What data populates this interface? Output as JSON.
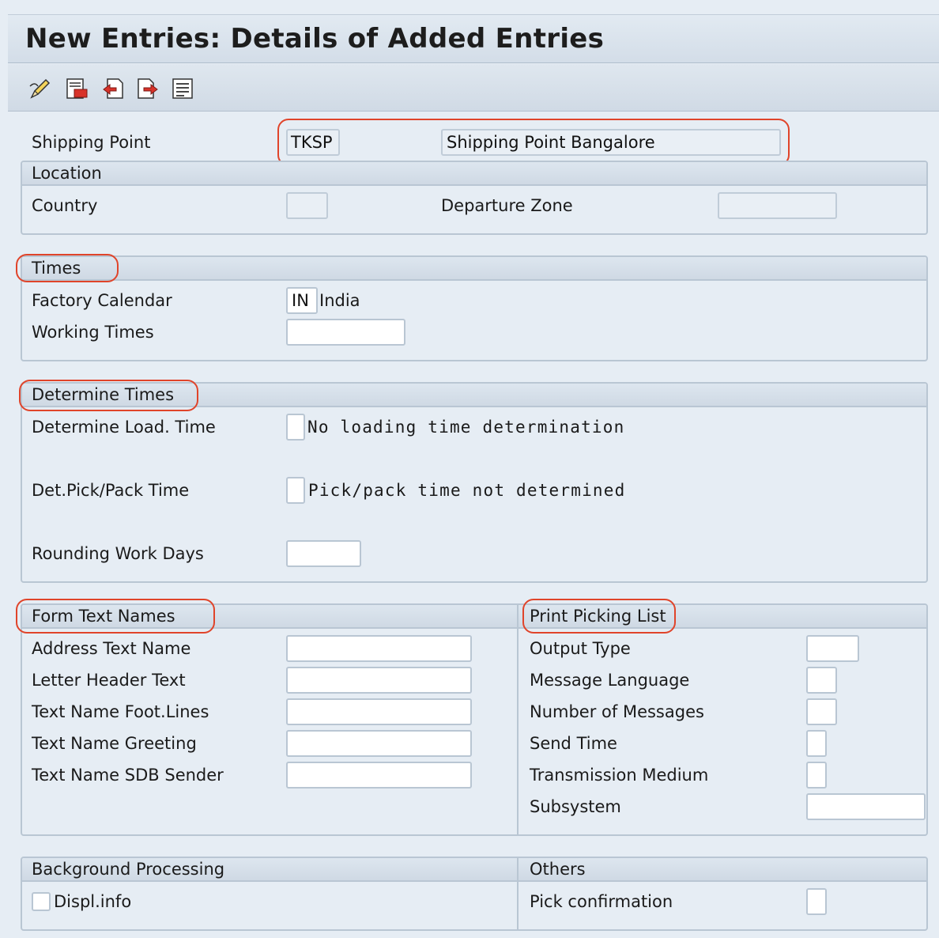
{
  "title": "New Entries: Details of Added Entries",
  "toolbar": {
    "icons": [
      "edit-pen-icon",
      "delete-entry-icon",
      "previous-entry-icon",
      "next-entry-icon",
      "document-list-icon"
    ]
  },
  "header": {
    "shipping_point_label": "Shipping Point",
    "shipping_point_code": "TKSP",
    "shipping_point_desc": "Shipping Point Bangalore"
  },
  "location": {
    "title": "Location",
    "country_label": "Country",
    "country_value": "",
    "departure_zone_label": "Departure Zone",
    "departure_zone_value": ""
  },
  "times": {
    "title": "Times",
    "factory_calendar_label": "Factory Calendar",
    "factory_calendar_code": "IN",
    "factory_calendar_desc": "India",
    "working_times_label": "Working Times",
    "working_times_value": ""
  },
  "determine_times": {
    "title": "Determine Times",
    "load_label": "Determine Load. Time",
    "load_text": "No loading time determination",
    "pick_label": "Det.Pick/Pack Time",
    "pick_text": "Pick/pack time not determined",
    "rounding_label": "Rounding Work Days",
    "rounding_value": ""
  },
  "form_text_names": {
    "title": "Form Text Names",
    "fields": [
      {
        "label": "Address Text Name",
        "value": ""
      },
      {
        "label": "Letter Header Text",
        "value": ""
      },
      {
        "label": "Text Name Foot.Lines",
        "value": ""
      },
      {
        "label": "Text Name Greeting",
        "value": ""
      },
      {
        "label": "Text Name SDB Sender",
        "value": ""
      }
    ]
  },
  "print_picking_list": {
    "title": "Print Picking List",
    "fields": [
      {
        "label": "Output Type",
        "value": ""
      },
      {
        "label": "Message Language",
        "value": ""
      },
      {
        "label": "Number of Messages",
        "value": ""
      },
      {
        "label": "Send Time",
        "value": ""
      },
      {
        "label": "Transmission Medium",
        "value": ""
      },
      {
        "label": "Subsystem",
        "value": ""
      }
    ]
  },
  "background_processing": {
    "title": "Background Processing",
    "displ_info_label": "Displ.info",
    "displ_info_checked": false
  },
  "others": {
    "title": "Others",
    "pick_confirmation_label": "Pick confirmation",
    "pick_confirmation_value": ""
  },
  "colors": {
    "highlight": "#e0442a",
    "background": "#e6edf4",
    "border": "#b9c6d3"
  }
}
